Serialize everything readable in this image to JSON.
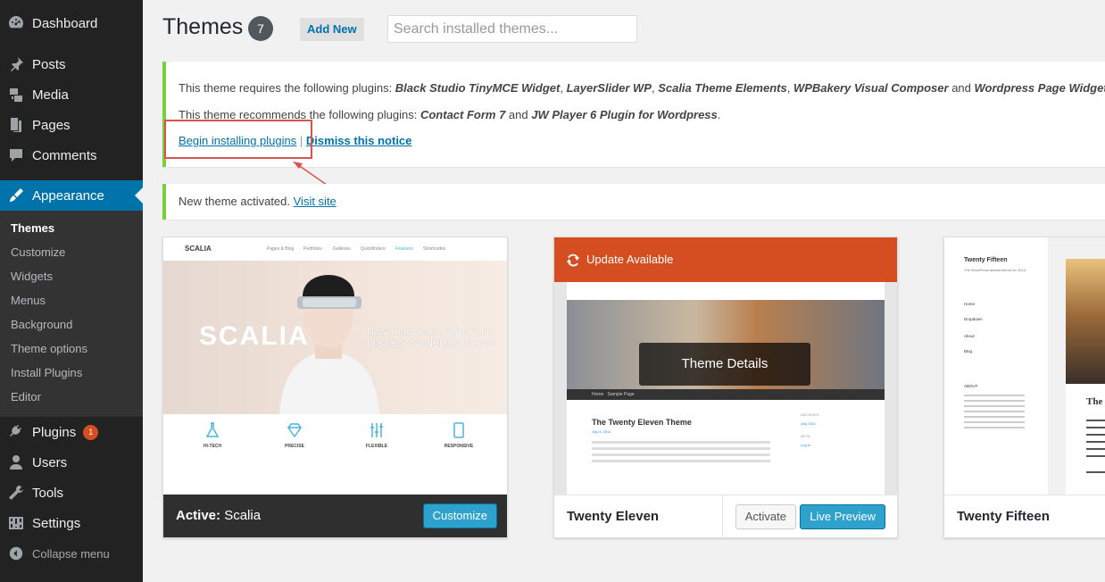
{
  "sidebar": {
    "items": [
      {
        "label": "Dashboard",
        "icon": "dashboard-icon"
      },
      {
        "label": "Posts",
        "icon": "pin-icon"
      },
      {
        "label": "Media",
        "icon": "media-icon"
      },
      {
        "label": "Pages",
        "icon": "pages-icon"
      },
      {
        "label": "Comments",
        "icon": "comment-icon"
      },
      {
        "label": "Appearance",
        "icon": "brush-icon"
      }
    ],
    "submenu": [
      "Themes",
      "Customize",
      "Widgets",
      "Menus",
      "Background",
      "Theme options",
      "Install Plugins",
      "Editor"
    ],
    "lower_items": [
      {
        "label": "Plugins",
        "icon": "plugin-icon",
        "badge": "1"
      },
      {
        "label": "Users",
        "icon": "users-icon"
      },
      {
        "label": "Tools",
        "icon": "wrench-icon"
      },
      {
        "label": "Settings",
        "icon": "settings-icon"
      }
    ],
    "collapse_label": "Collapse menu"
  },
  "header": {
    "title": "Themes",
    "count": "7",
    "add_new": "Add New",
    "search_placeholder": "Search installed themes..."
  },
  "notice_plugins": {
    "requires_prefix": "This theme requires the following plugins: ",
    "required": [
      "Black Studio TinyMCE Widget",
      "LayerSlider WP",
      "Scalia Theme Elements",
      "WPBakery Visual Composer"
    ],
    "required_last": "Wordpress Page Widgets",
    "recommends_prefix": "This theme recommends the following plugins: ",
    "recommended_1": "Contact Form 7",
    "recommended_2": "JW Player 6 Plugin for Wordpress",
    "begin_link": "Begin installing plugins",
    "separator": "|",
    "dismiss_link": "Dismiss this notice"
  },
  "notice_activated": {
    "text": "New theme activated. ",
    "link": "Visit site"
  },
  "themes": [
    {
      "active_label": "Active:",
      "name": "Scalia",
      "action": "Customize",
      "preview": {
        "logo": "SCALIA",
        "nav": [
          "Pages & Blog",
          "Portfolios",
          "Galleries",
          "Quickfinders",
          "Features",
          "Shortcodes"
        ],
        "hero_word": "SCALIA",
        "tagline_1": "New Trendsetter In Premium",
        "tagline_2": "Business WordPress Themes",
        "features": [
          {
            "title": "HI-TECH",
            "icon": "flask-icon"
          },
          {
            "title": "PRECISE",
            "icon": "diamond-icon"
          },
          {
            "title": "FLEXIBLE",
            "icon": "sliders-icon"
          },
          {
            "title": "RESPONSIVE",
            "icon": "tablet-icon"
          }
        ]
      }
    },
    {
      "banner": "Update Available",
      "overlay": "Theme Details",
      "name": "Twenty Eleven",
      "activate": "Activate",
      "live_preview": "Live Preview",
      "preview": {
        "nav": [
          "Home",
          "Sample Page"
        ],
        "post_title": "The Twenty Eleven Theme",
        "date": "July 8, 2011",
        "archives": "ARCHIVES",
        "archive_item": "July 2011",
        "meta_title": "META",
        "meta_item": "Log in"
      }
    },
    {
      "name": "Twenty Fifteen",
      "preview": {
        "site_title": "Twenty Fifteen",
        "site_desc": "The WordPress default theme for 2015.",
        "menu": [
          "Home",
          "Dropdown",
          "About",
          "Blog"
        ],
        "about_title": "ABOUT",
        "post_title_partial": "The",
        "colors": {
          "accent": "#f1f1f1"
        }
      }
    }
  ],
  "colors": {
    "sidebar_bg": "#222222",
    "current_menu": "#0073aa",
    "notice_border": "#7ad03a",
    "update_banner": "#d54e21",
    "primary_button": "#2ea2cc",
    "highlight": "#d9534f"
  }
}
